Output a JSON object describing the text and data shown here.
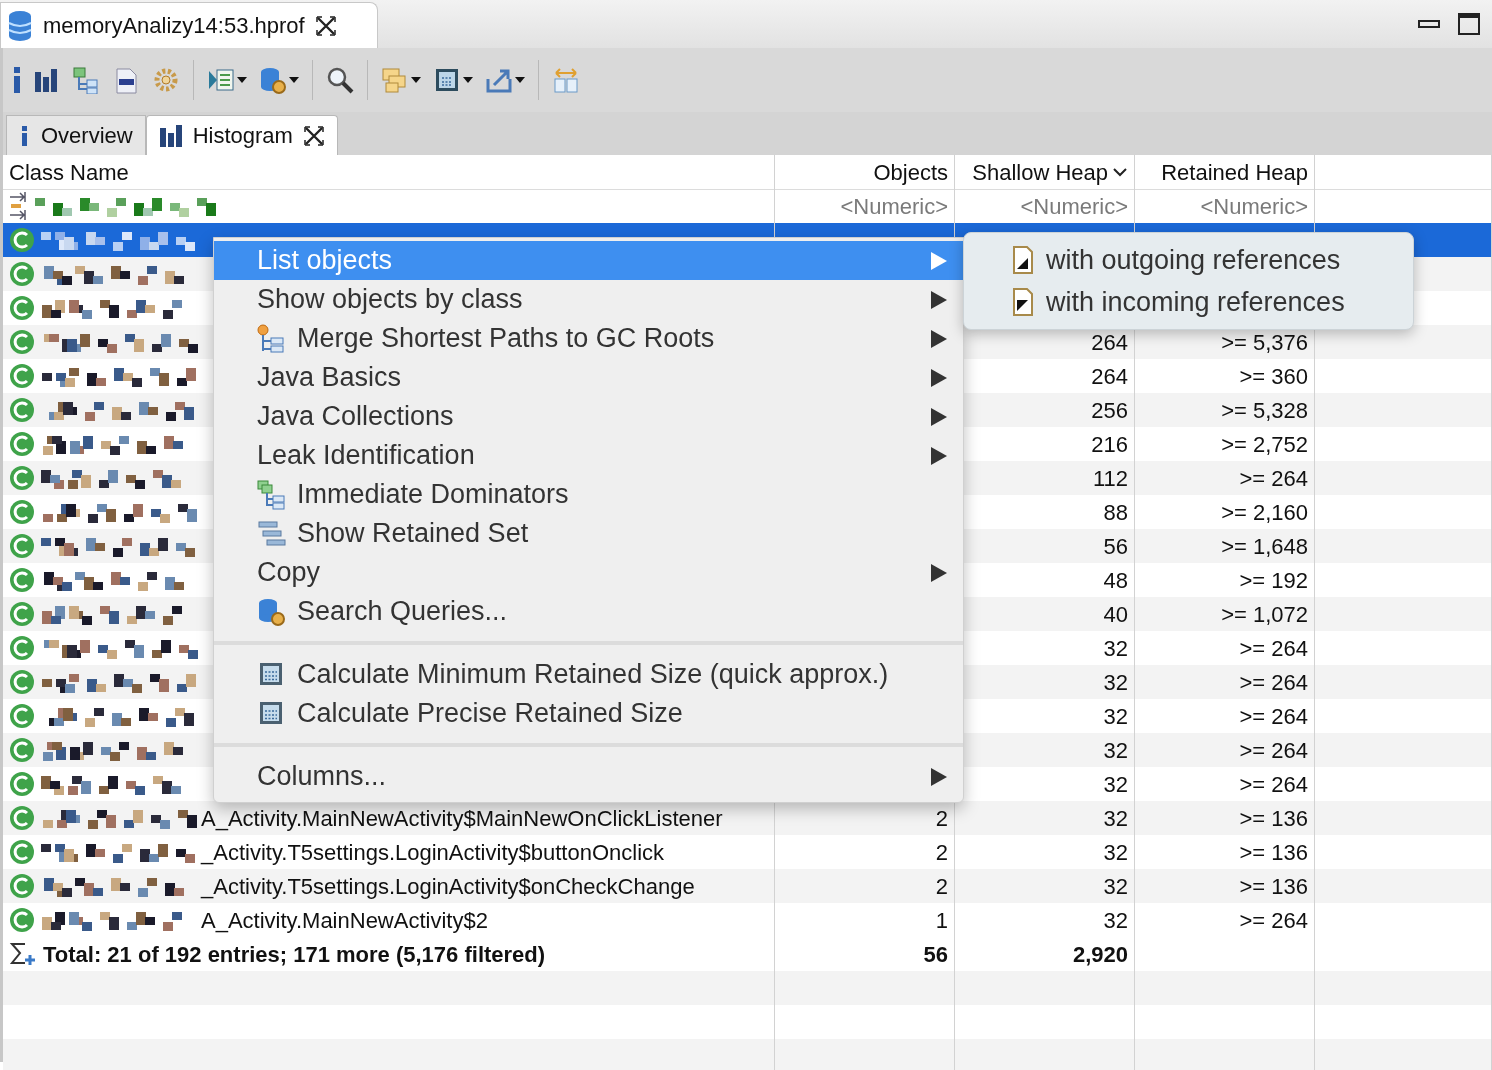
{
  "file_tab": {
    "title": "memoryAnalizy14:53.hprof",
    "closable": true
  },
  "editor_tabs": [
    {
      "label": "Overview",
      "selected": false
    },
    {
      "label": "Histogram",
      "selected": true,
      "closable": true
    }
  ],
  "table": {
    "columns": [
      {
        "label": "Class Name",
        "sorted": false
      },
      {
        "label": "Objects",
        "sorted": false
      },
      {
        "label": "Shallow Heap",
        "sorted": true
      },
      {
        "label": "Retained Heap",
        "sorted": false
      }
    ],
    "filters": [
      {
        "placeholder": "<Numeric>"
      },
      {
        "placeholder": "<Numeric>"
      },
      {
        "placeholder": "<Numeric>"
      }
    ],
    "rows": [
      {
        "selected": true
      },
      {
        "selected": false
      },
      {
        "selected": false
      },
      {
        "selected": false,
        "shallow_heap": "264",
        "retained_heap": ">= 5,376"
      },
      {
        "selected": false,
        "shallow_heap": "264",
        "retained_heap": ">= 360"
      },
      {
        "selected": false,
        "shallow_heap": "256",
        "retained_heap": ">= 5,328"
      },
      {
        "selected": false,
        "shallow_heap": "216",
        "retained_heap": ">= 2,752"
      },
      {
        "selected": false,
        "shallow_heap": "112",
        "retained_heap": ">= 264"
      },
      {
        "selected": false,
        "shallow_heap": "88",
        "retained_heap": ">= 2,160"
      },
      {
        "selected": false,
        "shallow_heap": "56",
        "retained_heap": ">= 1,648"
      },
      {
        "selected": false,
        "shallow_heap": "48",
        "retained_heap": ">= 192"
      },
      {
        "selected": false,
        "shallow_heap": "40",
        "retained_heap": ">= 1,072"
      },
      {
        "selected": false,
        "shallow_heap": "32",
        "retained_heap": ">= 264"
      },
      {
        "selected": false,
        "shallow_heap": "32",
        "retained_heap": ">= 264"
      },
      {
        "selected": false,
        "shallow_heap": "32",
        "retained_heap": ">= 264"
      },
      {
        "selected": false,
        "shallow_heap": "32",
        "retained_heap": ">= 264"
      },
      {
        "selected": false,
        "shallow_heap": "32",
        "retained_heap": ">= 264"
      },
      {
        "selected": false,
        "class_name": "A_Activity.MainNewActivity$MainNewOnClickListener",
        "objects": "2",
        "shallow_heap": "32",
        "retained_heap": ">= 136"
      },
      {
        "selected": false,
        "class_name": "_Activity.T5settings.LoginActivity$buttonOnclick",
        "objects": "2",
        "shallow_heap": "32",
        "retained_heap": ">= 136"
      },
      {
        "selected": false,
        "class_name": "_Activity.T5settings.LoginActivity$onCheckChange",
        "objects": "2",
        "shallow_heap": "32",
        "retained_heap": ">= 136"
      },
      {
        "selected": false,
        "class_name": "A_Activity.MainNewActivity$2",
        "objects": "1",
        "shallow_heap": "32",
        "retained_heap": ">= 264"
      }
    ],
    "total": {
      "label": "Total: 21 of 192 entries; 171 more (5,176 filtered)",
      "objects": "56",
      "shallow_heap": "2,920"
    }
  },
  "context_menu": {
    "items": [
      {
        "kind": "item",
        "label": "List objects",
        "selected": true,
        "submenu": true,
        "icon": false
      },
      {
        "kind": "item",
        "label": "Show objects by class",
        "selected": false,
        "submenu": true,
        "icon": false
      },
      {
        "kind": "item",
        "label": "Merge Shortest Paths to GC Roots",
        "selected": false,
        "submenu": true,
        "icon": true
      },
      {
        "kind": "item",
        "label": "Java Basics",
        "selected": false,
        "submenu": true,
        "icon": false
      },
      {
        "kind": "item",
        "label": "Java Collections",
        "selected": false,
        "submenu": true,
        "icon": false
      },
      {
        "kind": "item",
        "label": "Leak Identification",
        "selected": false,
        "submenu": true,
        "icon": false
      },
      {
        "kind": "item",
        "label": "Immediate Dominators",
        "selected": false,
        "submenu": false,
        "icon": true
      },
      {
        "kind": "item",
        "label": "Show Retained Set",
        "selected": false,
        "submenu": false,
        "icon": true
      },
      {
        "kind": "item",
        "label": "Copy",
        "selected": false,
        "submenu": true,
        "icon": false
      },
      {
        "kind": "item",
        "label": "Search Queries...",
        "selected": false,
        "submenu": false,
        "icon": true
      },
      {
        "kind": "separator"
      },
      {
        "kind": "item",
        "label": "Calculate Minimum Retained Size (quick approx.)",
        "selected": false,
        "submenu": false,
        "icon": true
      },
      {
        "kind": "item",
        "label": "Calculate Precise Retained Size",
        "selected": false,
        "submenu": false,
        "icon": true
      },
      {
        "kind": "separator"
      },
      {
        "kind": "item",
        "label": "Columns...",
        "selected": false,
        "submenu": true,
        "icon": false
      }
    ]
  },
  "submenu": {
    "items": [
      {
        "label": "with outgoing references"
      },
      {
        "label": "with incoming references"
      }
    ]
  }
}
